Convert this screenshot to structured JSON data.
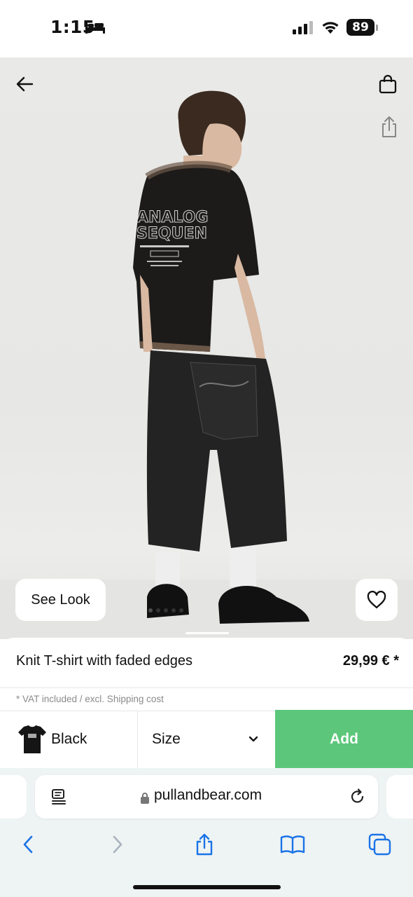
{
  "status_bar": {
    "time": "1:15",
    "battery": "89"
  },
  "hero": {
    "see_look_label": "See Look",
    "image_count": 5,
    "active_image_index": 0
  },
  "product": {
    "name": "Knit T-shirt with faded edges",
    "price": "29,99 € *",
    "vat_note": "* VAT included / excl. Shipping cost",
    "color": "Black",
    "size_label": "Size",
    "add_label": "Add",
    "accent_color": "#5cc77a"
  },
  "browser": {
    "url": "pullandbear.com"
  },
  "icons": {
    "back": "back-arrow-icon",
    "bag": "shopping-bag-icon",
    "share": "share-icon",
    "wishlist": "heart-icon",
    "reader": "reader-mode-icon",
    "lock": "lock-icon",
    "reload": "reload-icon",
    "safari_back": "chevron-left-icon",
    "safari_forward": "chevron-right-icon",
    "safari_share": "share-icon",
    "bookmarks": "book-icon",
    "tabs": "tabs-icon"
  }
}
